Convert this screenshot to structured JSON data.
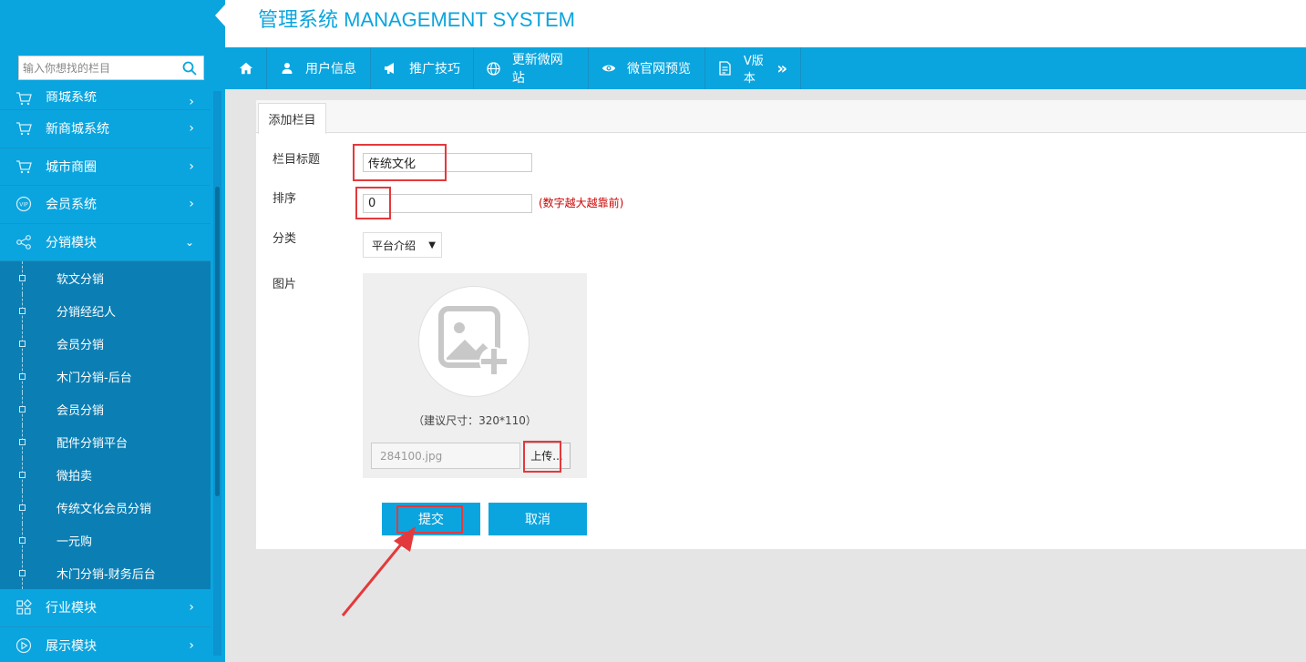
{
  "app": {
    "title": "管理系统 MANAGEMENT SYSTEM"
  },
  "search": {
    "placeholder": "输入你想找的栏目"
  },
  "sidebar": {
    "items_top": [
      {
        "label": "商城系统",
        "icon": "cart-icon"
      },
      {
        "label": "新商城系统",
        "icon": "cart-icon"
      },
      {
        "label": "城市商圈",
        "icon": "cart-icon"
      },
      {
        "label": "会员系统",
        "icon": "vip-icon"
      },
      {
        "label": "分销模块",
        "icon": "share-icon",
        "expanded": true
      }
    ],
    "subitems": [
      "软文分销",
      "分销经纪人",
      "会员分销",
      "木门分销-后台",
      "会员分销",
      "配件分销平台",
      "微拍卖",
      "传统文化会员分销",
      "一元购",
      "木门分销-财务后台"
    ],
    "items_bottom": [
      {
        "label": "行业模块",
        "icon": "grid-icon"
      },
      {
        "label": "展示模块",
        "icon": "play-icon"
      }
    ]
  },
  "topnav": {
    "items": [
      {
        "label": "用户信息",
        "icon": "user-icon"
      },
      {
        "label": "推广技巧",
        "icon": "megaphone-icon"
      },
      {
        "label": "更新微网站",
        "icon": "globe-icon"
      },
      {
        "label": "微官网预览",
        "icon": "eye-icon"
      },
      {
        "label": "V版本",
        "icon": "doc-icon"
      }
    ]
  },
  "panel": {
    "tab": "添加栏目",
    "fields": {
      "title_label": "栏目标题",
      "title_value": "传统文化",
      "sort_label": "排序",
      "sort_value": "0",
      "sort_hint": "(数字越大越靠前)",
      "category_label": "分类",
      "category_value": "平台介绍",
      "image_label": "图片",
      "image_size_hint": "（建议尺寸：320*110）",
      "file_name": "284100.jpg",
      "upload_label": "上传..."
    },
    "submit_label": "提交",
    "cancel_label": "取消"
  },
  "colors": {
    "primary": "#0aa5df",
    "highlight": "#e4393c"
  }
}
